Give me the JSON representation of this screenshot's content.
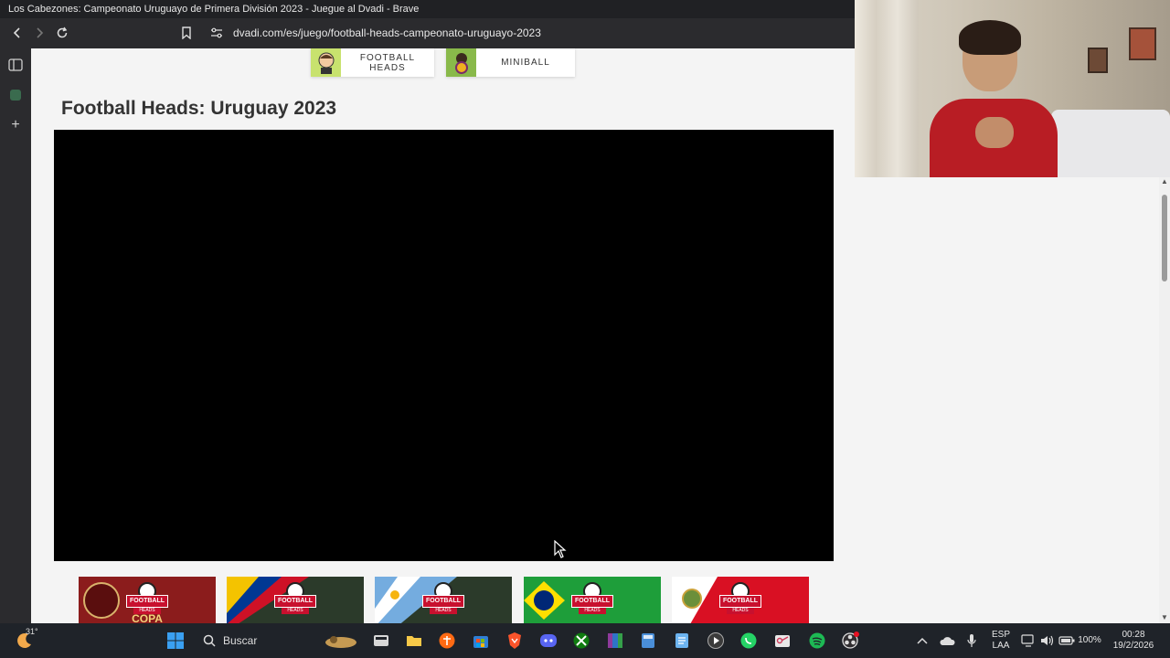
{
  "window": {
    "title": "Los Cabezones: Campeonato Uruguayo de Primera División 2023 - Juegue al Dvadi - Brave"
  },
  "toolbar": {
    "url": "dvadi.com/es/juego/football-heads-campeonato-uruguayo-2023"
  },
  "page": {
    "top_tiles": [
      {
        "label": "FOOTBALL HEADS",
        "icon": "football-heads-thumb"
      },
      {
        "label": "MINIBALL",
        "icon": "miniball-thumb"
      }
    ],
    "title": "Football Heads: Uruguay 2023",
    "related_games": [
      {
        "banner": "FOOTBALL",
        "sub": "HEADS",
        "theme": "copa",
        "bg": "#8b1c1c",
        "caption": "COPA"
      },
      {
        "banner": "FOOTBALL",
        "sub": "HEADS",
        "theme": "colombia",
        "bg": "#f4c300"
      },
      {
        "banner": "FOOTBALL",
        "sub": "HEADS",
        "theme": "argentina",
        "bg": "#74acdf"
      },
      {
        "banner": "FOOTBALL",
        "sub": "HEADS",
        "theme": "brazil",
        "bg": "#1e9e3a"
      },
      {
        "banner": "FOOTBALL",
        "sub": "HEADS",
        "theme": "peru",
        "bg": "#d91023"
      }
    ]
  },
  "taskbar": {
    "weather_temp": "31°",
    "search_label": "Buscar",
    "language": "ESP",
    "layout": "LAA",
    "battery": "100%",
    "time": "00:28",
    "date": "19/2/2026"
  },
  "colors": {
    "titlebar": "#202124",
    "navbar": "#2b2b2e",
    "game_frame": "#000000",
    "taskbar": "#1f2329"
  }
}
